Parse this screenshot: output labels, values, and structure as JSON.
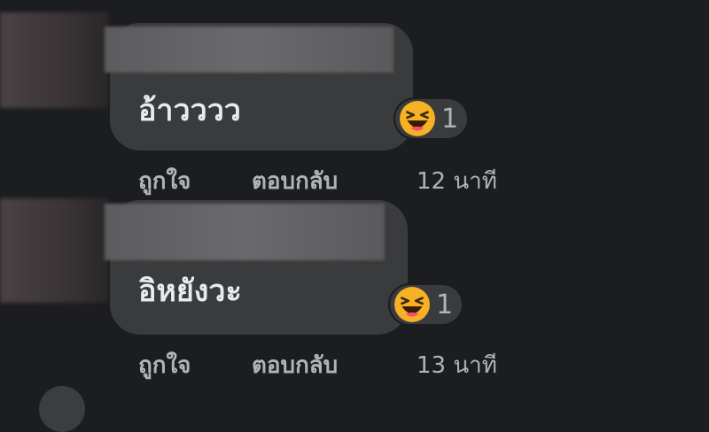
{
  "comments": [
    {
      "text": "อ้าวววว",
      "reaction_count": "1",
      "like_label": "ถูกใจ",
      "reply_label": "ตอบกลับ",
      "time_label": "12 นาที"
    },
    {
      "text": "อิหยังวะ",
      "reaction_count": "1",
      "like_label": "ถูกใจ",
      "reply_label": "ตอบกลับ",
      "time_label": "13 นาที"
    }
  ],
  "reaction_icon": "laughing-emoji-icon",
  "colors": {
    "background": "#1c1d21",
    "bubble": "#3a3b3c",
    "text": "#e9eaed",
    "muted": "#b0b3b8",
    "emoji_yellow": "#f7b125"
  }
}
